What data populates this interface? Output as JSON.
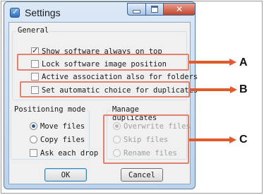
{
  "window": {
    "title": "Settings",
    "buttons": {
      "minimize": "—",
      "maximize": "□",
      "close": "✕"
    }
  },
  "general": {
    "legend": "General",
    "options": [
      {
        "label": "Show software always on top",
        "checked": true
      },
      {
        "label": "Lock software image position",
        "checked": false
      },
      {
        "label": "Active association also for folders",
        "checked": false
      },
      {
        "label": "Set automatic choice for duplicates",
        "checked": false
      }
    ]
  },
  "positioning": {
    "legend": "Positioning mode",
    "move_files": "Move files",
    "copy_files": "Copy files",
    "ask_each_drop": "Ask each drop",
    "selected": "Move files"
  },
  "duplicates": {
    "legend": "Manage duplicates",
    "overwrite_files": "Overwrite files",
    "skip_files": "Skip files",
    "rename_files": "Rename files",
    "selected": "Overwrite files",
    "enabled": false
  },
  "actions": {
    "ok": "OK",
    "cancel": "Cancel"
  },
  "callouts": {
    "a": "A",
    "b": "B",
    "c": "C"
  },
  "colors": {
    "highlight": "#e0826f",
    "arrow": "#e35a2a",
    "close_button": "#c2432b"
  }
}
